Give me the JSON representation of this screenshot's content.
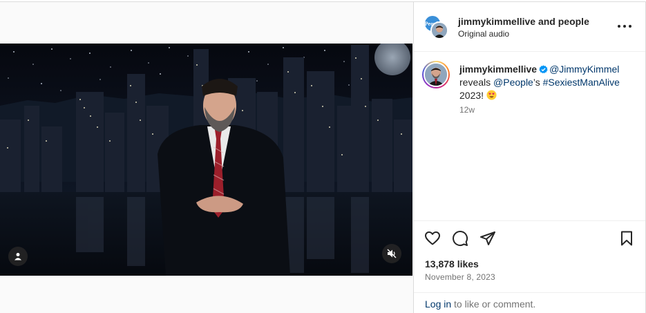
{
  "post": {
    "header": {
      "owner_username": "jimmykimmellive",
      "collab_text": "and people",
      "audio_label": "Original audio",
      "more_icon": "more-horizontal-icon"
    },
    "caption": {
      "username": "jimmykimmellive",
      "verified": true,
      "mention_1": "@JimmyKimmel",
      "text_1": "reveals",
      "mention_2": "@People",
      "text_2": "’s",
      "hashtag": "#SexiestManAlive",
      "text_3": "2023!",
      "emoji": "heart-eyes-emoji",
      "time_ago": "12w"
    },
    "actions": {
      "like_icon": "heart-icon",
      "comment_icon": "comment-icon",
      "share_icon": "send-icon",
      "save_icon": "bookmark-icon"
    },
    "likes_text": "13,878 likes",
    "date_text": "November 8, 2023",
    "login": {
      "link_text": "Log in",
      "rest_text": " to like or comment."
    },
    "media": {
      "tag_icon": "user-tag-icon",
      "mute_icon": "speaker-muted-icon"
    }
  },
  "colors": {
    "link": "#00376b",
    "verified": "#0095f6",
    "secondary_text": "#737373",
    "border": "#dbdbdb"
  }
}
